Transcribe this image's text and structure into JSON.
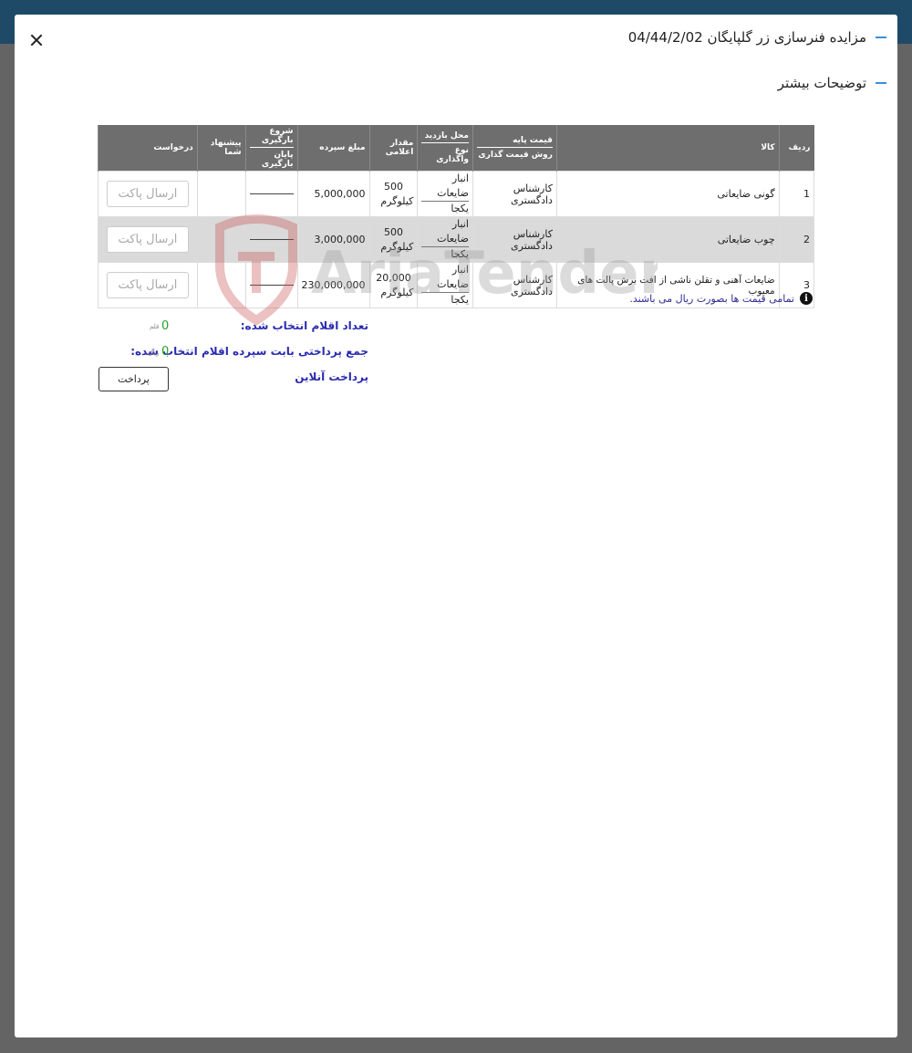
{
  "header": {
    "title": "مزایده فنرسازی زر گلپایگان 04/44/2/02",
    "subtitle": "توضیحات بیشتر"
  },
  "table": {
    "columns": {
      "row": "ردیف",
      "item": "کالا",
      "base_price": "قیمت پایه",
      "pricing_method": "روش قیمت گذاری",
      "visit_location": "محل بازدید",
      "transfer_type": "نوع واگذاری",
      "quantity": "مقدار اعلامی",
      "deposit": "مبلغ سپرده",
      "loading_start": "شروع بارگیری",
      "loading_end": "پایان بارگیری",
      "your_offer": "پیشنهاد شما",
      "request": "درخواست"
    },
    "rows": [
      {
        "index": "1",
        "item": "گونی ضایعاتی",
        "pricing": "کارشناس دادگستری",
        "location": "انبار ضایعات",
        "transfer": "یکجا",
        "qty": "500",
        "unit": "کیلوگرم",
        "deposit": "5,000,000",
        "button": "ارسال پاکت"
      },
      {
        "index": "2",
        "item": "چوب ضایعاتی",
        "pricing": "کارشناس دادگستری",
        "location": "انبار ضایعات",
        "transfer": "یکجا",
        "qty": "500",
        "unit": "کیلوگرم",
        "deposit": "3,000,000",
        "button": "ارسال پاکت"
      },
      {
        "index": "3",
        "item": "ضایعات آهنی و تقلن ناشی از افت برش پالت های معیوب",
        "pricing": "کارشناس دادگستری",
        "location": "انبار ضایعات",
        "transfer": "یکجا",
        "qty": "20,000",
        "unit": "کیلوگرم",
        "deposit": "230,000,000",
        "button": "ارسال پاکت"
      }
    ]
  },
  "note": {
    "icon": "info-icon",
    "text": "تمامی قیمت ها بصورت ریال می باشند."
  },
  "summary": {
    "selected_count_label": "تعداد اقلام انتخاب شده:",
    "selected_count_value": "0",
    "selected_count_unit": "قلم",
    "payment_total_label": "جمع پرداختی بابت سپرده اقلام انتخاب شده:",
    "payment_total_value": "0",
    "payment_total_unit": "ریال",
    "online_payment_label": "پرداخت آنلاین",
    "pay_button": "پرداخت"
  },
  "watermark": {
    "text": "AriaTender.neT"
  },
  "colors": {
    "topbar": "#1e4a68",
    "header_dash": "#3a8fd8",
    "table_header": "#6e6e6e",
    "summary_text": "#2b2bb0",
    "value_green": "#2aa12a",
    "watermark": "#c85050"
  }
}
